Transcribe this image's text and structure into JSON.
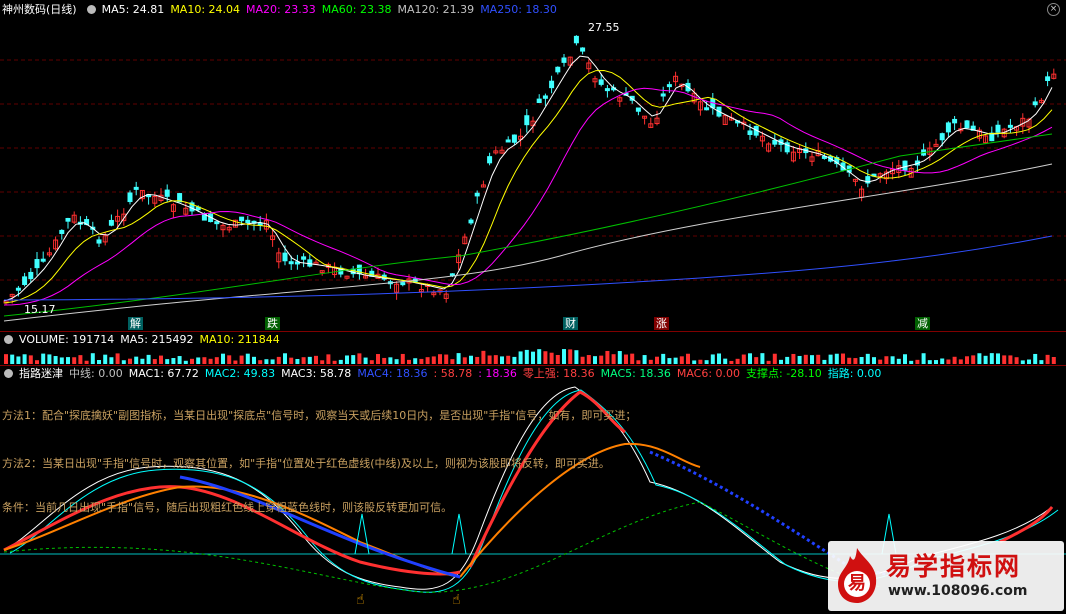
{
  "main": {
    "title": "神州数码(日线)",
    "ma": [
      {
        "label": "MA5: 24.81",
        "color": "#ffffff"
      },
      {
        "label": "MA10: 24.04",
        "color": "#ffff00"
      },
      {
        "label": "MA20: 23.33",
        "color": "#ff00ff"
      },
      {
        "label": "MA60: 23.38",
        "color": "#00ff00"
      },
      {
        "label": "MA120: 21.39",
        "color": "#c0c0c0"
      },
      {
        "label": "MA250: 18.30",
        "color": "#3050ff"
      }
    ],
    "high_label": "27.55",
    "low_label": "15.17",
    "markers": [
      {
        "text": "解",
        "bg": "#006060",
        "color": "#ffffff"
      },
      {
        "text": "跌",
        "bg": "#006000",
        "color": "#ffffff"
      },
      {
        "text": "财",
        "bg": "#006060",
        "color": "#ffffff"
      },
      {
        "text": "涨",
        "bg": "#800000",
        "color": "#ffffff"
      },
      {
        "text": "减",
        "bg": "#006000",
        "color": "#ffffff"
      }
    ]
  },
  "volume": {
    "items": [
      {
        "label": "VOLUME: 191714",
        "color": "#ffffff"
      },
      {
        "label": "MA5: 215492",
        "color": "#ffffff"
      },
      {
        "label": "MA10: 211844",
        "color": "#ffff00"
      }
    ]
  },
  "indicator": {
    "items": [
      {
        "label": "指路迷津",
        "color": "#ffffff"
      },
      {
        "label": "中线: 0.00",
        "color": "#c0c0c0"
      },
      {
        "label": "MAC1: 67.72",
        "color": "#ffffff"
      },
      {
        "label": "MAC2: 49.83",
        "color": "#00ffff"
      },
      {
        "label": "MAC3: 58.78",
        "color": "#ffffff"
      },
      {
        "label": "MAC4: 18.36",
        "color": "#3050ff"
      },
      {
        "label": ": 58.78",
        "color": "#ff4040"
      },
      {
        "label": ": 18.36",
        "color": "#ff00ff"
      },
      {
        "label": "零上强: 18.36",
        "color": "#ff4040"
      },
      {
        "label": "MAC5: 18.36",
        "color": "#00ff80"
      },
      {
        "label": "MAC6: 0.00",
        "color": "#ff4040"
      },
      {
        "label": "支撑点: -28.10",
        "color": "#00ff00"
      },
      {
        "label": "指路: 0.00",
        "color": "#00ffff"
      }
    ],
    "notes": [
      "方法1：配合\"探底擒妖\"副图指标，当某日出现\"探底点\"信号时，观察当天或后续10日内，是否出现\"手指\"信号，如有，即可买进；",
      "方法2：当某日出现\"手指\"信号时，观察其位置，如\"手指\"位置处于红色虚线(中线)及以上，则视为该股即将反转，即可买进。",
      "条件：当前几日出现\"手指\"信号，随后出现粗红色线上穿粗蓝色线时，则该股反转更加可信。"
    ]
  },
  "watermark": {
    "name": "易学指标网",
    "url": "www.108096.com",
    "logo_char": "易"
  }
}
